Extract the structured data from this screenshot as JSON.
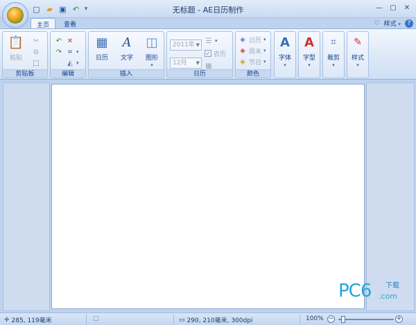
{
  "window": {
    "title": "无标题 - AE日历制作"
  },
  "quick_access": {
    "more_glyph": "▾"
  },
  "tabs": [
    {
      "label": "主页",
      "active": true
    },
    {
      "label": "查看",
      "active": false
    }
  ],
  "right_tools": {
    "heart": "♡",
    "style_label": "样式",
    "help": "?"
  },
  "ribbon": {
    "clipboard": {
      "label": "剪贴板",
      "paste": "粘贴"
    },
    "edit": {
      "label": "编辑"
    },
    "insert": {
      "label": "插入",
      "calendar": "日历",
      "text": "文字",
      "shape": "图形"
    },
    "calendar": {
      "label": "日历",
      "year": "2011年",
      "month": "12月",
      "lunar": "农历"
    },
    "color": {
      "label": "颜色",
      "day": "日历",
      "weekend": "周末",
      "holiday": "节日"
    },
    "font": {
      "label": "字体"
    },
    "font_type": {
      "label": "字型"
    },
    "crop": {
      "label": "裁剪"
    },
    "style": {
      "label": "样式"
    }
  },
  "status": {
    "cursor": "285, 119毫米",
    "page_size": "290, 210毫米, 300dpi",
    "zoom": "100%",
    "zoom_level": 0.05
  },
  "watermark": {
    "main": "PC6",
    "cn": "下载",
    "com": ".com"
  },
  "colors": {
    "accent": "#15428b",
    "ribbon_bg": "#dbe7f7",
    "workspace": "#bfd3ee",
    "watermark": "#25a4d8"
  }
}
